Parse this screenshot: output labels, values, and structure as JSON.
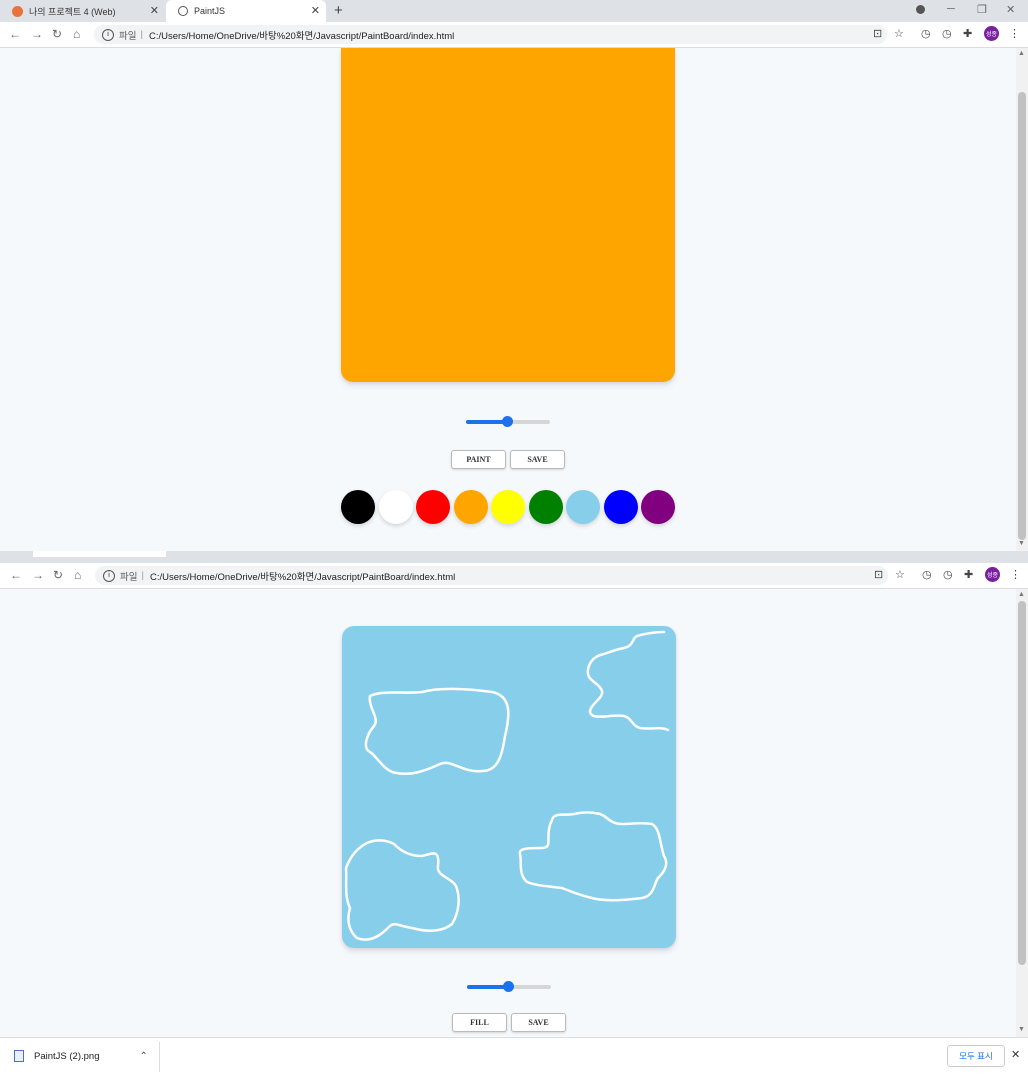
{
  "tabs": [
    {
      "title": "나의 프로젝트 4 (Web)",
      "favicon_color": "#e8743b"
    },
    {
      "title": "PaintJS",
      "favicon_color": "#555555"
    }
  ],
  "address_bar": {
    "scheme_label": "파일",
    "url": "C:/Users/Home/OneDrive/바탕%20화면/Javascript/PaintBoard/index.html"
  },
  "profile_initials": "성종",
  "page1": {
    "canvas_color": "#ffa500",
    "brush_range": {
      "value": 0.5
    },
    "mode_button": "PAINT",
    "save_button": "SAVE",
    "palette": [
      "#000000",
      "#ffffff",
      "#ff0000",
      "#ffa500",
      "#ffff00",
      "#008000",
      "#87ceeb",
      "#0000ff",
      "#800080"
    ]
  },
  "page2": {
    "canvas_color": "#87ceeb",
    "stroke_color": "#ffffff",
    "brush_range": {
      "value": 0.5
    },
    "mode_button": "FILL",
    "save_button": "SAVE"
  },
  "downloads": {
    "file_name": "PaintJS (2).png",
    "show_all": "모두 표시"
  },
  "icons": [
    "back-icon",
    "forward-icon",
    "reload-icon",
    "home-icon",
    "info-icon",
    "translate-icon",
    "star-icon",
    "history-icon",
    "extensions-icon",
    "menu-icon",
    "close-icon",
    "chevron-up-icon",
    "download-file-icon"
  ]
}
